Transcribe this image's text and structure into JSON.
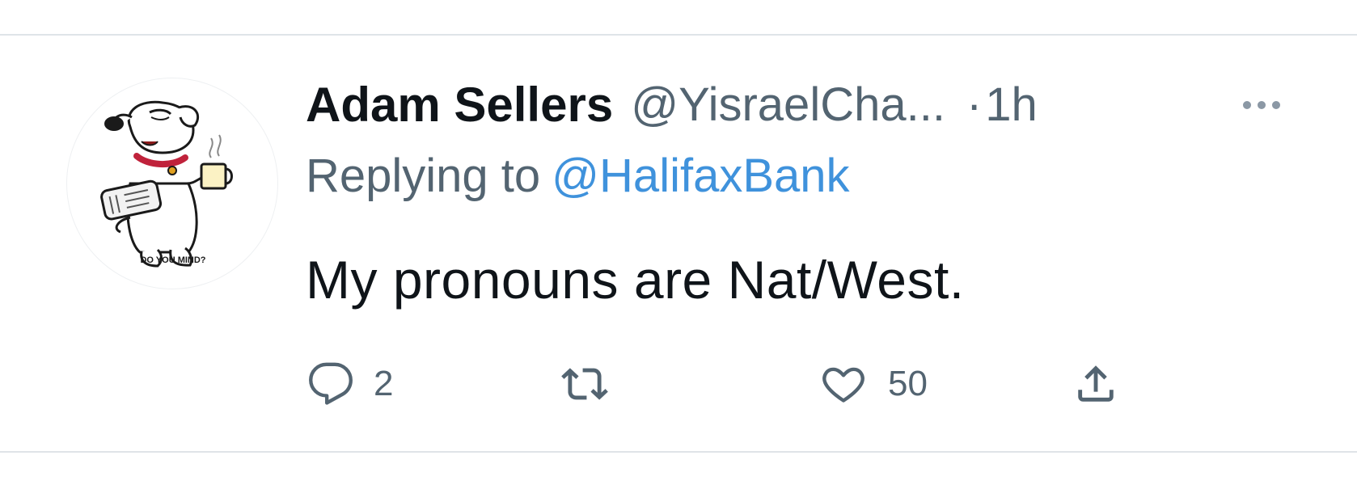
{
  "tweet": {
    "author": {
      "display_name": "Adam Sellers",
      "handle": "@YisraelCha...",
      "avatar_caption": "DO YOU MIND?"
    },
    "separator": "·",
    "time": "1h",
    "replying_prefix": "Replying to",
    "replying_to": "@HalifaxBank",
    "text": "My pronouns are Nat/West.",
    "actions": {
      "reply_count": "2",
      "retweet_count": "",
      "like_count": "50"
    },
    "icons": {
      "reply": "speech-bubble-icon",
      "retweet": "retweet-arrows-icon",
      "like": "heart-icon",
      "share": "upload-arrow-icon",
      "more": "ellipsis-icon"
    }
  },
  "colors": {
    "text_primary": "#0f1419",
    "text_secondary": "#536471",
    "link": "#3f92dc",
    "divider": "#dfe4e8"
  }
}
